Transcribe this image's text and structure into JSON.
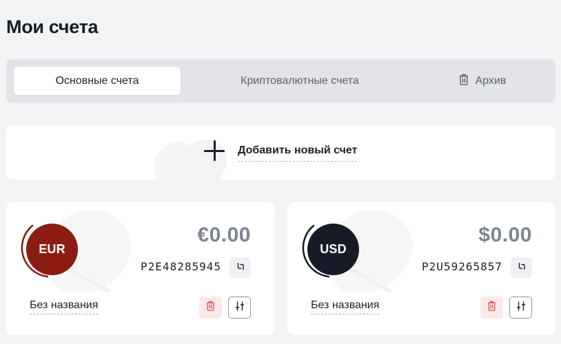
{
  "page": {
    "title": "Мои счета"
  },
  "tabs": [
    {
      "label": "Основные счета",
      "active": true
    },
    {
      "label": "Криптовалютные счета",
      "active": false
    },
    {
      "label": "Архив",
      "icon": "trash-icon",
      "active": false
    }
  ],
  "add_account": {
    "label": "Добавить новый счет",
    "icon": "plus-icon"
  },
  "accounts": [
    {
      "currency": "EUR",
      "amount": "€0.00",
      "number": "P2E48285945",
      "name": "Без названия",
      "color": "#8c1c12"
    },
    {
      "currency": "USD",
      "amount": "$0.00",
      "number": "P2U59265857",
      "name": "Без названия",
      "color": "#171b27"
    }
  ],
  "colors": {
    "background": "#f2f3f5",
    "card": "#ffffff",
    "tabs_bg": "#e3e4e8",
    "amount": "#7f8591",
    "delete_bg": "#fbe9ea",
    "delete_icon": "#d9534f"
  }
}
